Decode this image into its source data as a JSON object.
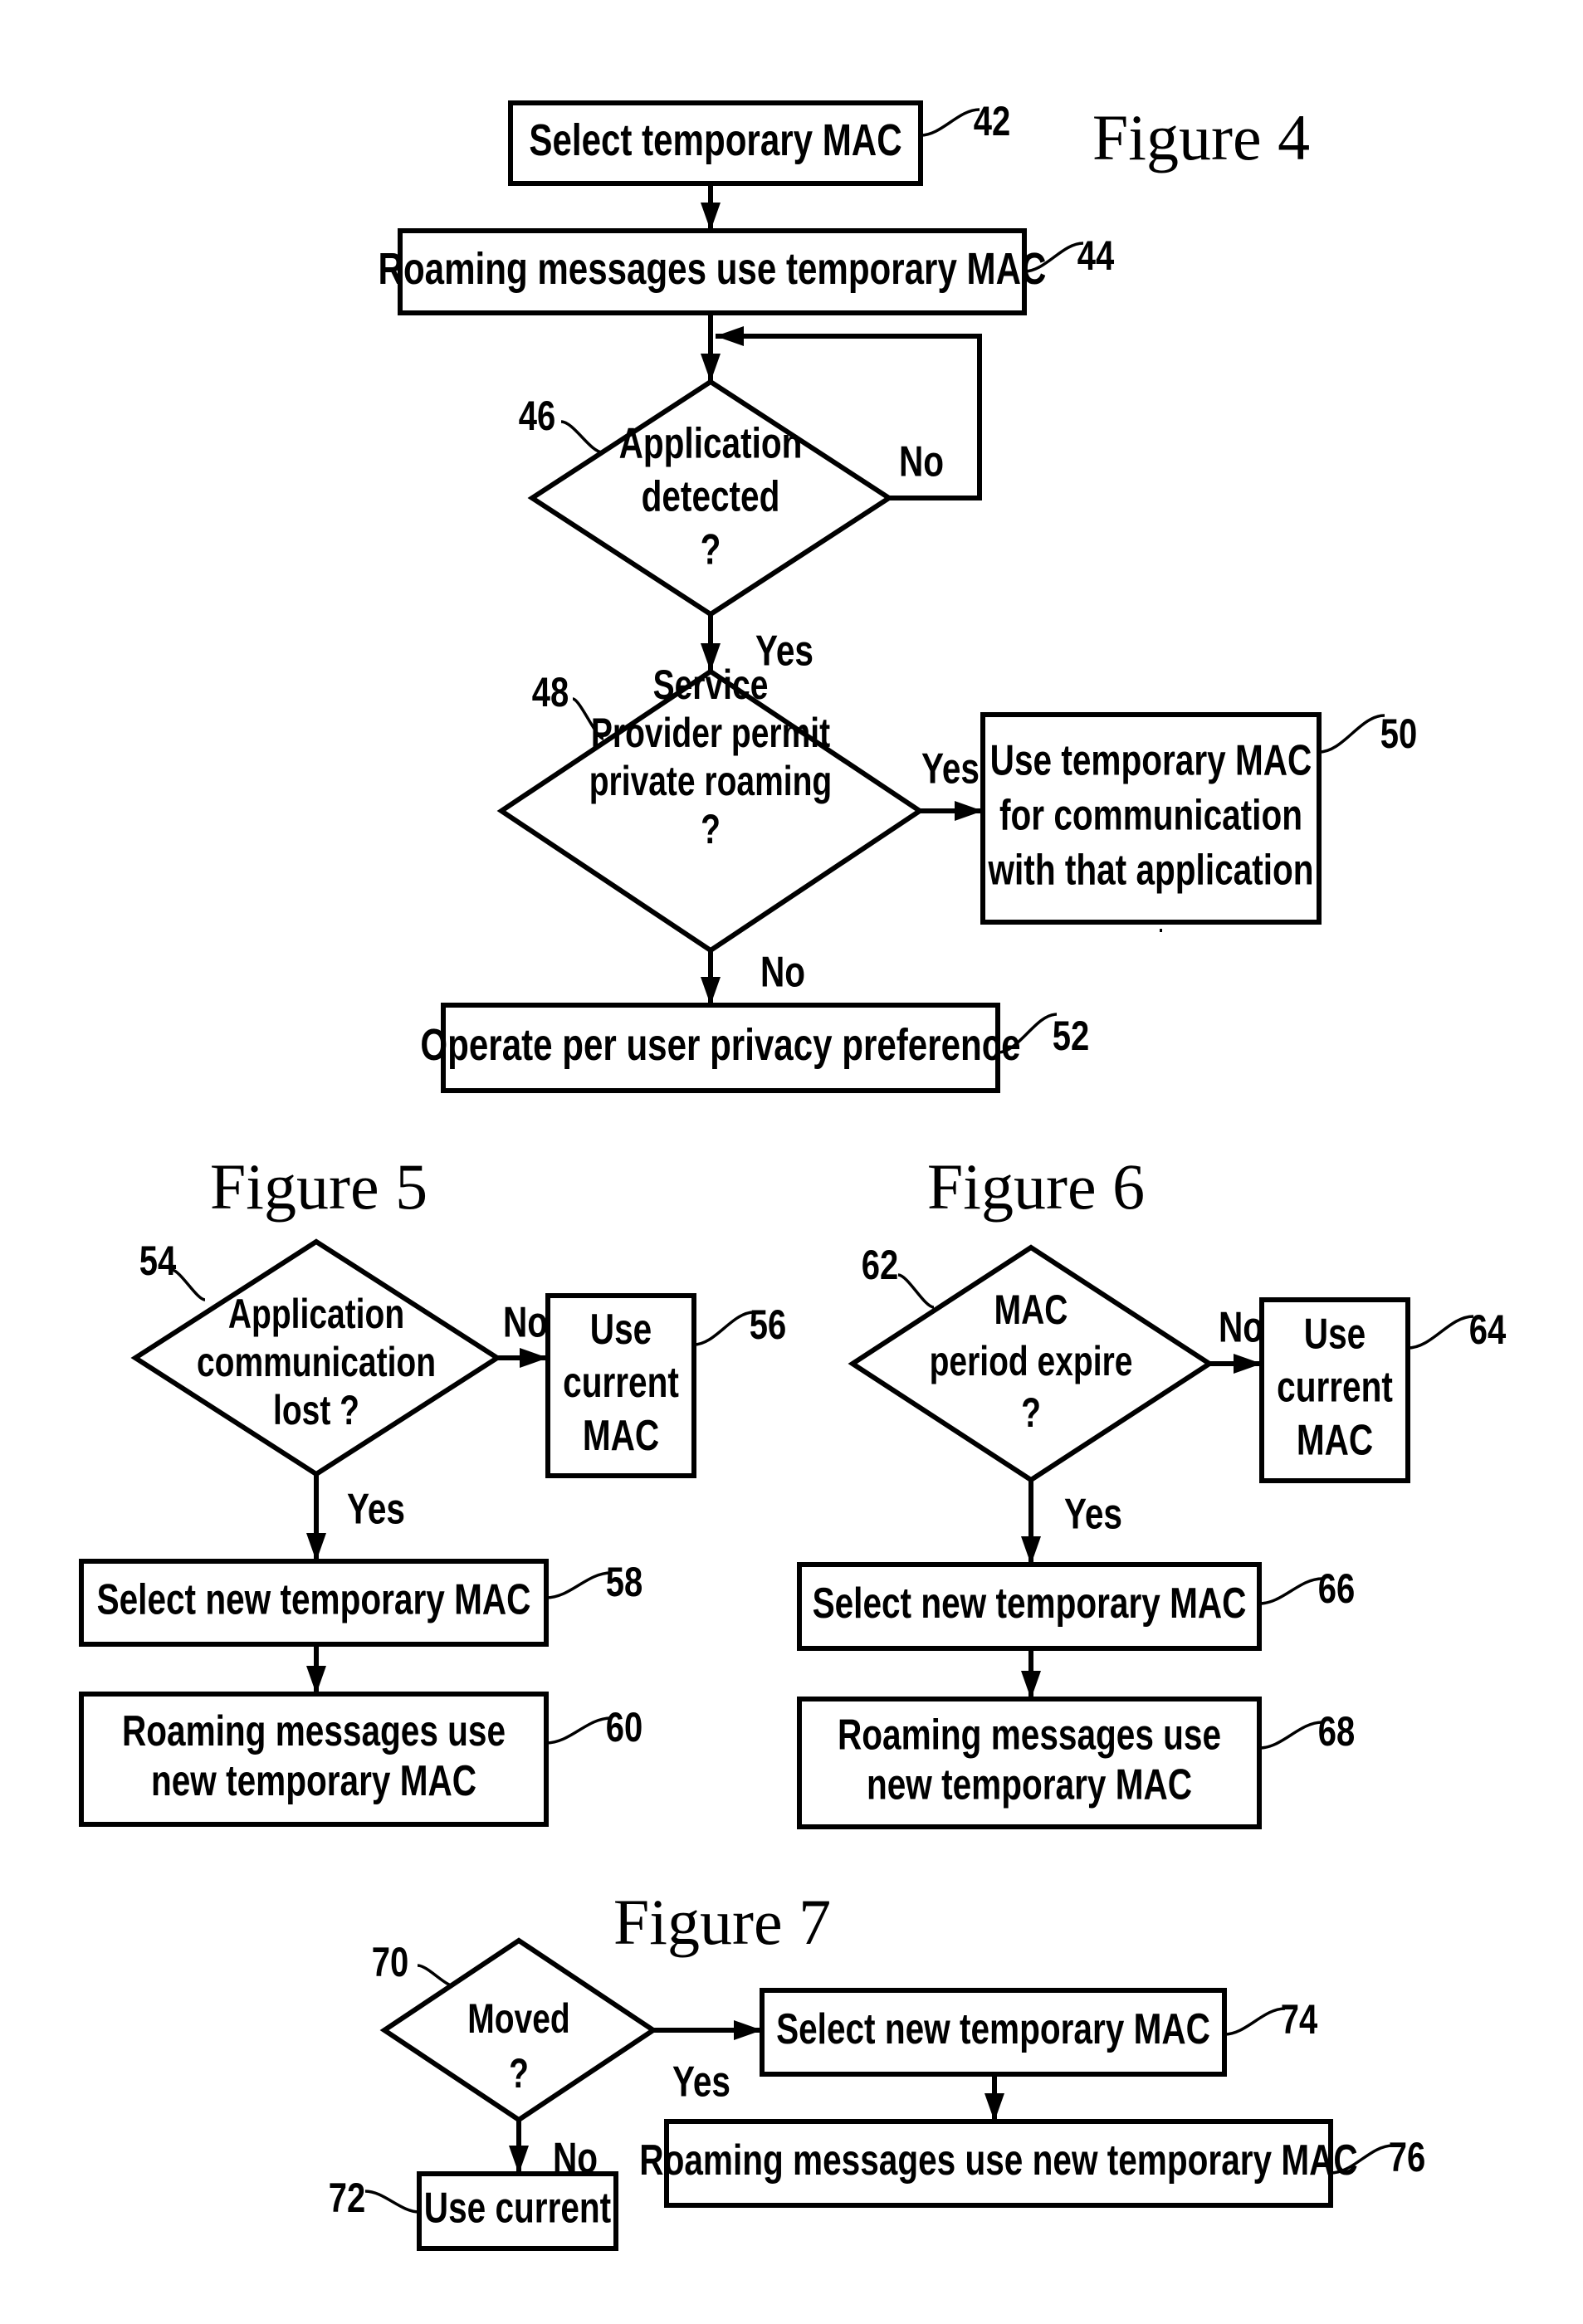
{
  "figures": [
    {
      "id": "fig4",
      "title": "Figure 4",
      "nodes": [
        {
          "id": "42",
          "shape": "box",
          "ref": "42",
          "lines": [
            "Select temporary MAC"
          ]
        },
        {
          "id": "44",
          "shape": "box",
          "ref": "44",
          "lines": [
            "Roaming messages use temporary MAC"
          ]
        },
        {
          "id": "46",
          "shape": "diamond",
          "ref": "46",
          "lines": [
            "Application",
            "detected",
            "?"
          ]
        },
        {
          "id": "48",
          "shape": "diamond",
          "ref": "48",
          "lines": [
            "Service",
            "Provider permit",
            "private roaming",
            "?"
          ]
        },
        {
          "id": "50",
          "shape": "box",
          "ref": "50",
          "lines": [
            "Use temporary MAC",
            "for communication",
            "with that application"
          ]
        },
        {
          "id": "52",
          "shape": "box",
          "ref": "52",
          "lines": [
            "Operate per user privacy preference"
          ]
        }
      ],
      "edges": [
        {
          "from": "42",
          "to": "44",
          "label": ""
        },
        {
          "from": "44",
          "to": "46",
          "label": ""
        },
        {
          "from": "46",
          "to": "46",
          "label": "No"
        },
        {
          "from": "46",
          "to": "48",
          "label": "Yes"
        },
        {
          "from": "48",
          "to": "50",
          "label": "Yes"
        },
        {
          "from": "48",
          "to": "52",
          "label": "No"
        }
      ]
    },
    {
      "id": "fig5",
      "title": "Figure 5",
      "nodes": [
        {
          "id": "54",
          "shape": "diamond",
          "ref": "54",
          "lines": [
            "Application",
            "communication",
            "lost ?"
          ]
        },
        {
          "id": "56",
          "shape": "box",
          "ref": "56",
          "lines": [
            "Use",
            "current",
            "MAC"
          ]
        },
        {
          "id": "58",
          "shape": "box",
          "ref": "58",
          "lines": [
            "Select new temporary MAC"
          ]
        },
        {
          "id": "60",
          "shape": "box",
          "ref": "60",
          "lines": [
            "Roaming messages use",
            "new temporary MAC"
          ]
        }
      ],
      "edges": [
        {
          "from": "54",
          "to": "56",
          "label": "No"
        },
        {
          "from": "54",
          "to": "58",
          "label": "Yes"
        },
        {
          "from": "58",
          "to": "60",
          "label": ""
        }
      ]
    },
    {
      "id": "fig6",
      "title": "Figure 6",
      "nodes": [
        {
          "id": "62",
          "shape": "diamond",
          "ref": "62",
          "lines": [
            "MAC",
            "period expire",
            "?"
          ]
        },
        {
          "id": "64",
          "shape": "box",
          "ref": "64",
          "lines": [
            "Use",
            "current",
            "MAC"
          ]
        },
        {
          "id": "66",
          "shape": "box",
          "ref": "66",
          "lines": [
            "Select new temporary MAC"
          ]
        },
        {
          "id": "68",
          "shape": "box",
          "ref": "68",
          "lines": [
            "Roaming messages use",
            "new temporary MAC"
          ]
        }
      ],
      "edges": [
        {
          "from": "62",
          "to": "64",
          "label": "No"
        },
        {
          "from": "62",
          "to": "66",
          "label": "Yes"
        },
        {
          "from": "66",
          "to": "68",
          "label": ""
        }
      ]
    },
    {
      "id": "fig7",
      "title": "Figure 7",
      "nodes": [
        {
          "id": "70",
          "shape": "diamond",
          "ref": "70",
          "lines": [
            "Moved",
            "?"
          ]
        },
        {
          "id": "72",
          "shape": "box",
          "ref": "72",
          "lines": [
            "Use current"
          ]
        },
        {
          "id": "74",
          "shape": "box",
          "ref": "74",
          "lines": [
            "Select new temporary MAC"
          ]
        },
        {
          "id": "76",
          "shape": "box",
          "ref": "76",
          "lines": [
            "Roaming messages use new temporary MAC"
          ]
        }
      ],
      "edges": [
        {
          "from": "70",
          "to": "74",
          "label": "Yes"
        },
        {
          "from": "70",
          "to": "72",
          "label": "No"
        },
        {
          "from": "74",
          "to": "76",
          "label": ""
        }
      ]
    }
  ]
}
